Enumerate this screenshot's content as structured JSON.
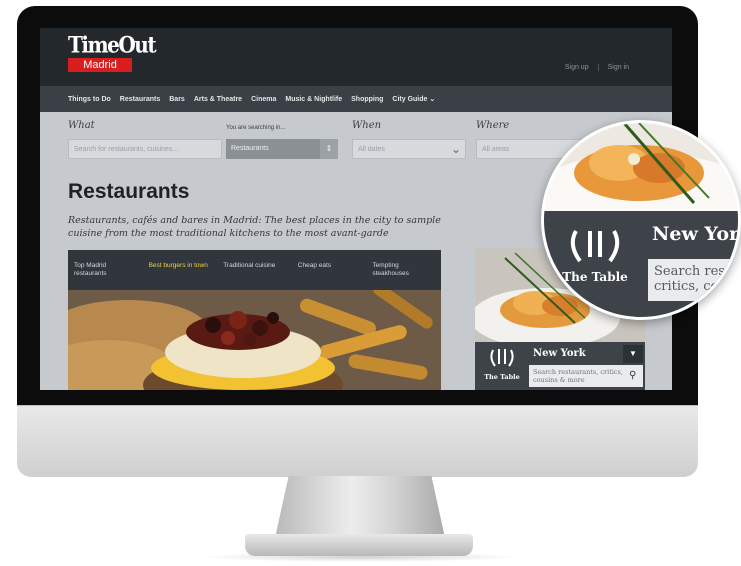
{
  "brand": {
    "logo_top": "TimeOut",
    "logo_city": "Madrid"
  },
  "auth": {
    "signup": "Sign up",
    "signin": "Sign in"
  },
  "nav": [
    "Things to Do",
    "Restaurants",
    "Bars",
    "Arts & Theatre",
    "Cinema",
    "Music & Nightlife",
    "Shopping",
    "City Guide ⌄"
  ],
  "search": {
    "what_label": "What",
    "what_placeholder": "Search for restaurants, cuisines...",
    "searching_in_label": "You are searching in...",
    "searching_in_value": "Restaurants",
    "when_label": "When",
    "when_value": "All dates",
    "where_label": "Where",
    "where_value": "All areas"
  },
  "page": {
    "title": "Restaurants",
    "subtitle": "Restaurants, cafés and bares in Madrid: The best places in the city to sample cuisine from the most traditional kitchens to the most avant-garde"
  },
  "tabs": [
    {
      "label": "Top Madrid restaurants",
      "active": false
    },
    {
      "label": "Best burgers in town",
      "active": true
    },
    {
      "label": "Traditional cuisine",
      "active": false
    },
    {
      "label": "Cheap eats",
      "active": false
    },
    {
      "label": "Tempting steakhouses",
      "active": false
    }
  ],
  "widget": {
    "brand": "The Table",
    "city": "New York",
    "search_placeholder": "Search restaurants, critics, cousins & more"
  },
  "zoom": {
    "brand": "The Table",
    "city": "New Yor",
    "search_text": "Search rest critics, co"
  },
  "colors": {
    "accent_red": "#d81e1e",
    "active_tab": "#f2d43a",
    "widget_dark": "#3d4349"
  }
}
